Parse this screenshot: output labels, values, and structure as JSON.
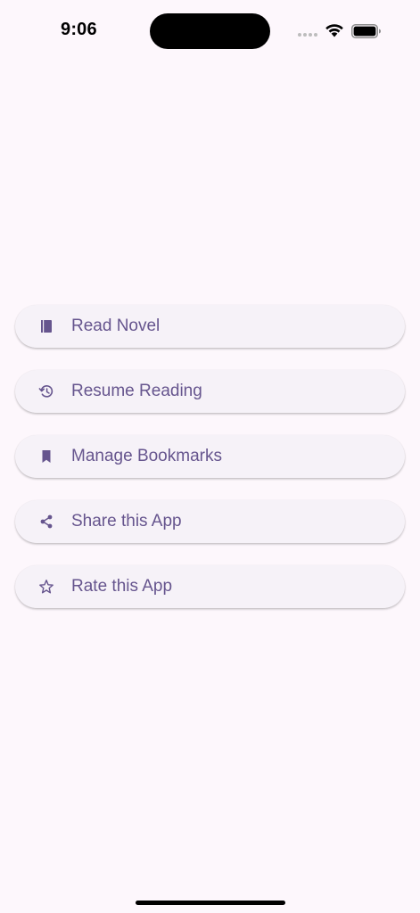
{
  "status_bar": {
    "time": "9:06"
  },
  "icons": {
    "wifi": "wifi-icon",
    "battery": "battery-icon",
    "read_novel": "book-icon",
    "resume_reading": "history-icon",
    "manage_bookmarks": "bookmark-icon",
    "share_app": "share-icon",
    "rate_app": "star-outline-icon"
  },
  "colors": {
    "background": "#fdf7fc",
    "button_background": "#f6f2f8",
    "accent": "#66558e"
  },
  "menu": {
    "items": [
      {
        "label": "Read Novel"
      },
      {
        "label": "Resume Reading"
      },
      {
        "label": "Manage Bookmarks"
      },
      {
        "label": "Share this App"
      },
      {
        "label": "Rate this App"
      }
    ]
  }
}
